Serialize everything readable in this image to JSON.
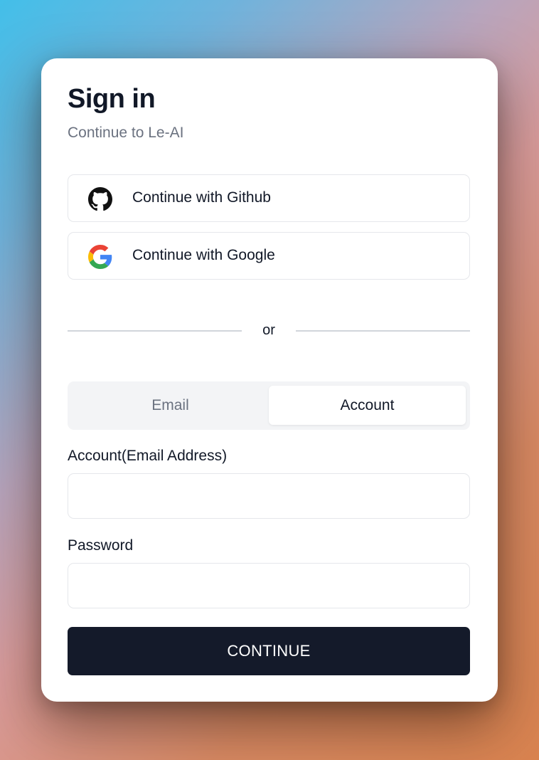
{
  "card": {
    "title": "Sign in",
    "subtitle": "Continue to Le-AI"
  },
  "oauth": {
    "github": {
      "label": "Continue with Github",
      "icon": "github-icon"
    },
    "google": {
      "label": "Continue with Google",
      "icon": "google-icon"
    }
  },
  "divider": {
    "text": "or"
  },
  "tabs": [
    {
      "label": "Email",
      "active": false
    },
    {
      "label": "Account",
      "active": true
    }
  ],
  "form": {
    "account_label": "Account(Email Address)",
    "account_value": "",
    "password_label": "Password",
    "password_value": "",
    "submit_label": "CONTINUE"
  },
  "colors": {
    "primary_button": "#141a2a",
    "text": "#111827",
    "muted_text": "#6b7280",
    "border": "#e5e7eb"
  }
}
